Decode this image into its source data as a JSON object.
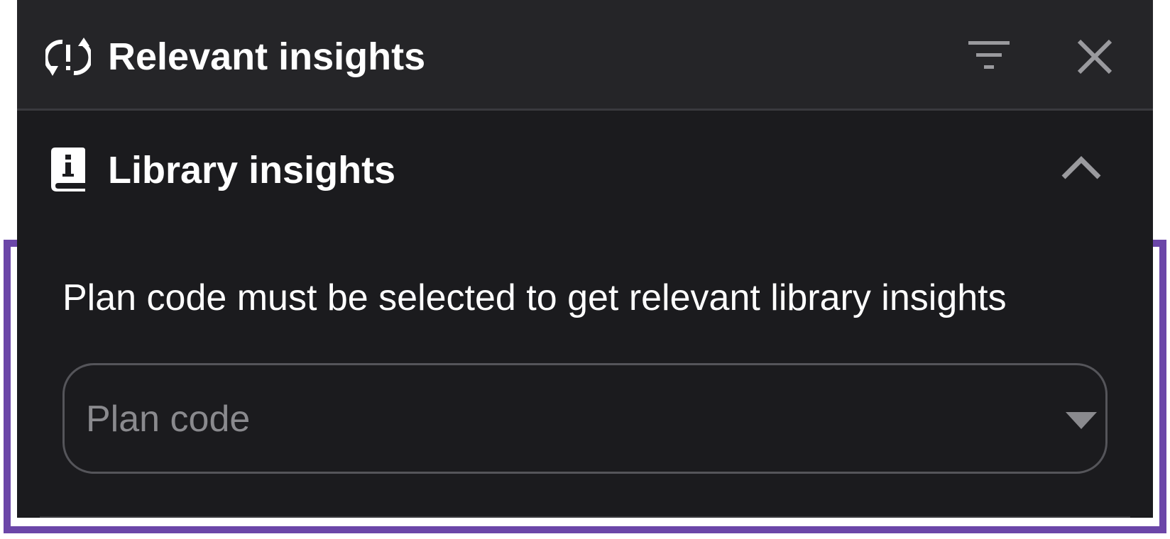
{
  "header": {
    "title": "Relevant insights",
    "icon": "insights-refresh-icon",
    "filter_icon": "filter-icon",
    "close_icon": "close-icon"
  },
  "library_section": {
    "title": "Library insights",
    "icon": "library-book-icon",
    "toggle_icon": "chevron-up-icon",
    "expanded": true,
    "message": "Plan code must be selected to get relevant library insights",
    "plan_code_select": {
      "placeholder": "Plan code",
      "value": ""
    }
  },
  "colors": {
    "header_bg": "#252528",
    "panel_bg": "#1b1b1e",
    "highlight_border": "#6b46a8",
    "text_primary": "#ffffff",
    "text_muted": "#8a8a8e"
  }
}
